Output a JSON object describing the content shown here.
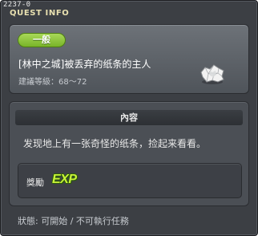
{
  "window": {
    "quest_id": "2237-0",
    "title": "QUEST INFO"
  },
  "quest": {
    "category": "一般",
    "name": "[林中之城]被丢弃的纸条的主人",
    "level": "建議等級：68～72",
    "icon": "crumpled-paper-icon"
  },
  "content": {
    "header": "內容",
    "description": "发现地上有一张奇怪的纸条，捡起来看看。"
  },
  "reward": {
    "label": "獎勵",
    "badge": "EXP"
  },
  "status": {
    "text": "狀態: 可開始 / 不可執行任務"
  },
  "colors": {
    "category_badge": "#8cc63f",
    "exp_badge": "#c8f23a",
    "title": "#e8e0b0"
  }
}
